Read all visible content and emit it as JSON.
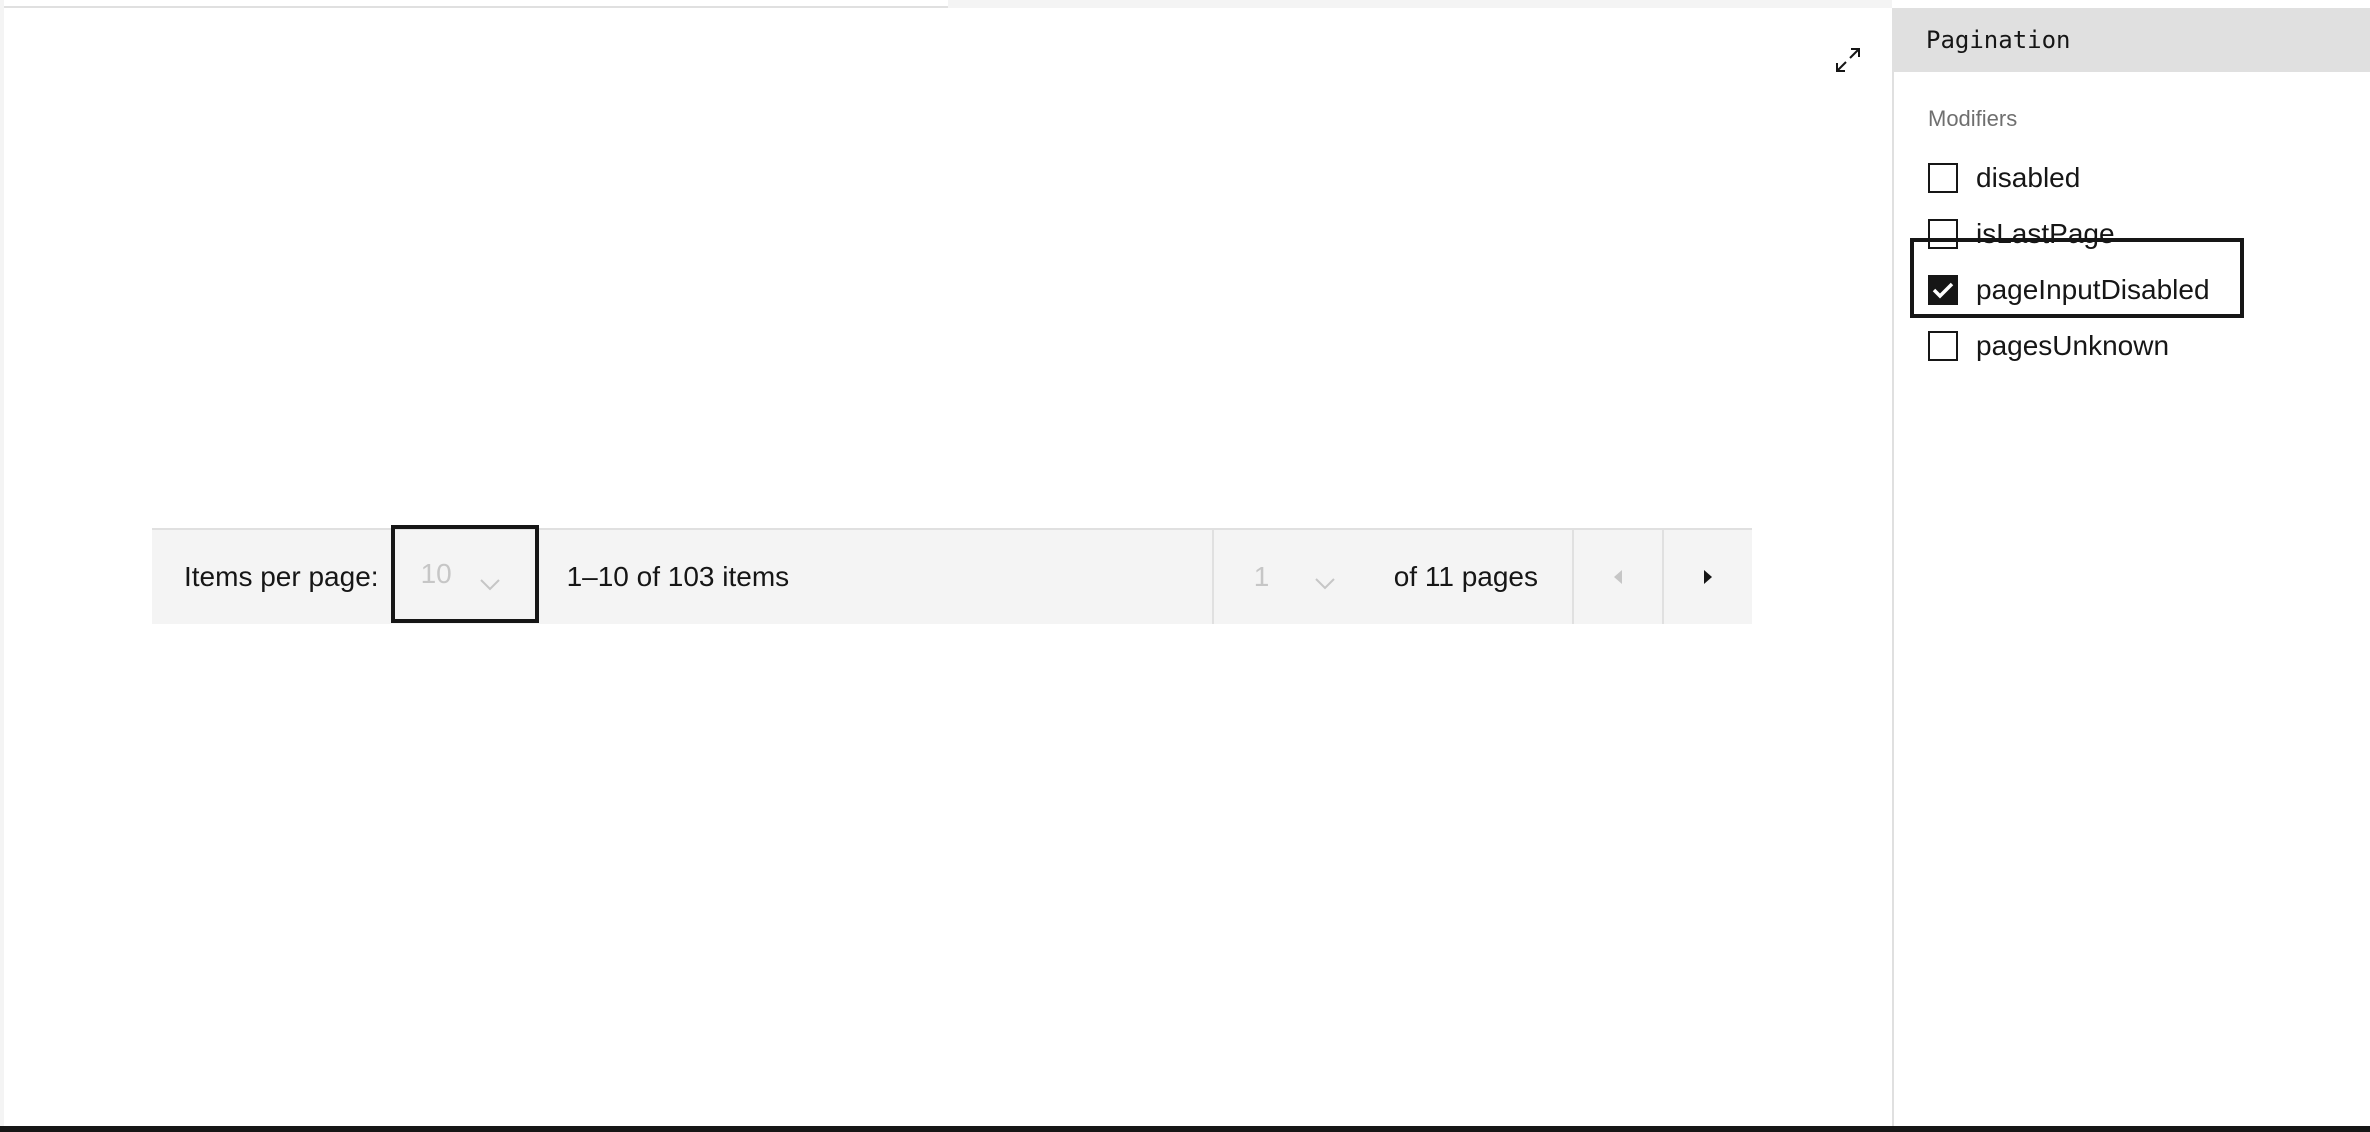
{
  "preview": {
    "expand_icon": "maximize-icon",
    "pagination": {
      "items_per_page_label": "Items per page:",
      "page_size_value": "10",
      "items_range_text": "1–10 of 103 items",
      "page_value": "1",
      "pages_text": "of 11 pages",
      "prev_icon": "caret-left-icon",
      "next_icon": "caret-right-icon"
    }
  },
  "panel": {
    "title": "Pagination",
    "section_label": "Modifiers",
    "modifiers": [
      {
        "label": "disabled",
        "checked": false
      },
      {
        "label": "isLastPage",
        "checked": false
      },
      {
        "label": "pageInputDisabled",
        "checked": true
      },
      {
        "label": "pagesUnknown",
        "checked": false
      }
    ]
  },
  "colors": {
    "text": "#161616",
    "disabled_text": "#c6c6c6",
    "bar_bg": "#f4f4f4",
    "panel_header_bg": "#e0e0e0",
    "muted_label": "#6f6f6f"
  }
}
